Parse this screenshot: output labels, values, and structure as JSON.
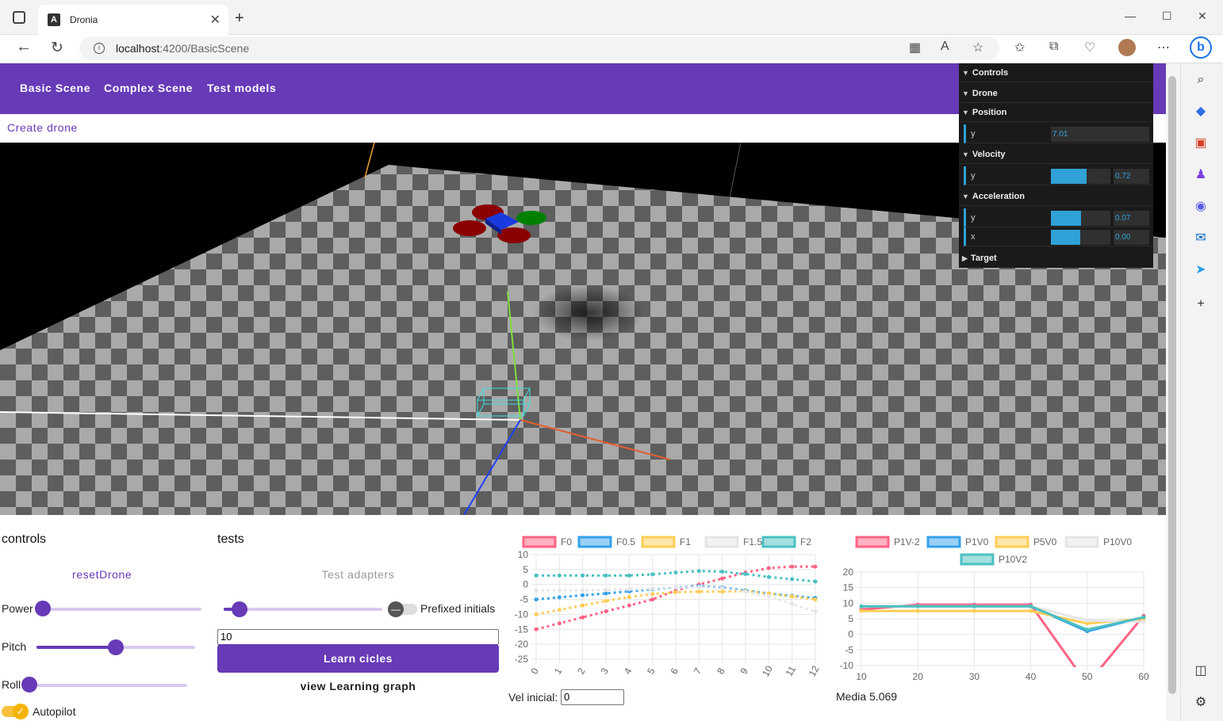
{
  "browser": {
    "tab_title": "Dronia",
    "url_host": "localhost",
    "url_path": ":4200/BasicScene"
  },
  "nav": {
    "links": [
      "Basic Scene",
      "Complex Scene",
      "Test models"
    ],
    "create_drone": "Create drone"
  },
  "gui": {
    "controls": "Controls",
    "drone": "Drone",
    "position": "Position",
    "position_y_label": "y",
    "position_y": "7.01",
    "velocity": "Velocity",
    "velocity_y_label": "y",
    "velocity_y": "0.72",
    "acceleration": "Acceleration",
    "acc_y_label": "y",
    "acc_y": "0.07",
    "acc_x_label": "x",
    "acc_x": "0.00",
    "target": "Target"
  },
  "controls": {
    "heading": "controls",
    "reset": "resetDrone",
    "power": "Power",
    "pitch": "Pitch",
    "roll": "Roll",
    "autopilot": "Autopilot"
  },
  "tests": {
    "heading": "tests",
    "adapters": "Test adapters",
    "prefixed": "Prefixed initials",
    "cycles_value": "10",
    "learn": "Learn cicles",
    "view_graph": "view Learning graph"
  },
  "chart1_labels": {
    "vel_label": "Vel inicial:",
    "vel_value": "0"
  },
  "chart2_labels": {
    "media": "Media 5.069"
  },
  "chart_data": [
    {
      "type": "line",
      "title": "",
      "x": [
        0,
        1,
        2,
        3,
        4,
        5,
        6,
        7,
        8,
        9,
        10,
        11,
        12
      ],
      "ylim": [
        -25,
        10
      ],
      "yticks": [
        10,
        5,
        0,
        -5,
        -10,
        -15,
        -20,
        -25
      ],
      "series": [
        {
          "name": "F0",
          "color": "#ff6384",
          "values": [
            -15,
            -13,
            -11,
            -9,
            -7,
            -5,
            -2,
            0,
            2,
            4,
            5.5,
            6,
            6
          ]
        },
        {
          "name": "F0.5",
          "color": "#36a2eb",
          "values": [
            -5,
            -4.3,
            -3.6,
            -3,
            -2.3,
            -1.6,
            -1,
            -0.5,
            -1,
            -2,
            -3,
            -3.8,
            -4.5
          ]
        },
        {
          "name": "F1",
          "color": "#ffcd56",
          "values": [
            -10,
            -8.5,
            -7,
            -5.5,
            -4.2,
            -3.2,
            -2.6,
            -2.4,
            -2.4,
            -2.2,
            -3,
            -4,
            -5
          ]
        },
        {
          "name": "F1.5",
          "color": "#e4e5e7",
          "values": [
            -2,
            -2,
            -2,
            -1.8,
            -1.6,
            -1.4,
            -1,
            -0.8,
            -1.2,
            -2.4,
            -4,
            -6.5,
            -9
          ]
        },
        {
          "name": "F2",
          "color": "#4bc0c0",
          "values": [
            3,
            3,
            3,
            3,
            3,
            3.4,
            4,
            4.5,
            4.3,
            3.5,
            2.5,
            1.8,
            1
          ]
        }
      ]
    },
    {
      "type": "line",
      "title": "",
      "x": [
        10,
        20,
        30,
        40,
        50,
        60
      ],
      "ylim": [
        -10,
        20
      ],
      "yticks": [
        20,
        15,
        10,
        5,
        0,
        -5,
        -10
      ],
      "series": [
        {
          "name": "P1V-2",
          "color": "#ff6384",
          "values": [
            8,
            9.5,
            9.5,
            9.5,
            -16,
            6
          ]
        },
        {
          "name": "P1V0",
          "color": "#36a2eb",
          "values": [
            9,
            9,
            9,
            9,
            1,
            5.5
          ]
        },
        {
          "name": "P5V0",
          "color": "#ffcd56",
          "values": [
            7.5,
            7.5,
            7.5,
            7.5,
            3.5,
            5
          ]
        },
        {
          "name": "P10V0",
          "color": "#e4e5e7",
          "values": [
            9,
            9,
            9,
            9,
            4.5,
            4
          ]
        },
        {
          "name": "P10V2",
          "color": "#4bc0c0",
          "values": [
            9,
            9,
            9,
            9,
            1.5,
            5.5
          ]
        }
      ]
    }
  ]
}
